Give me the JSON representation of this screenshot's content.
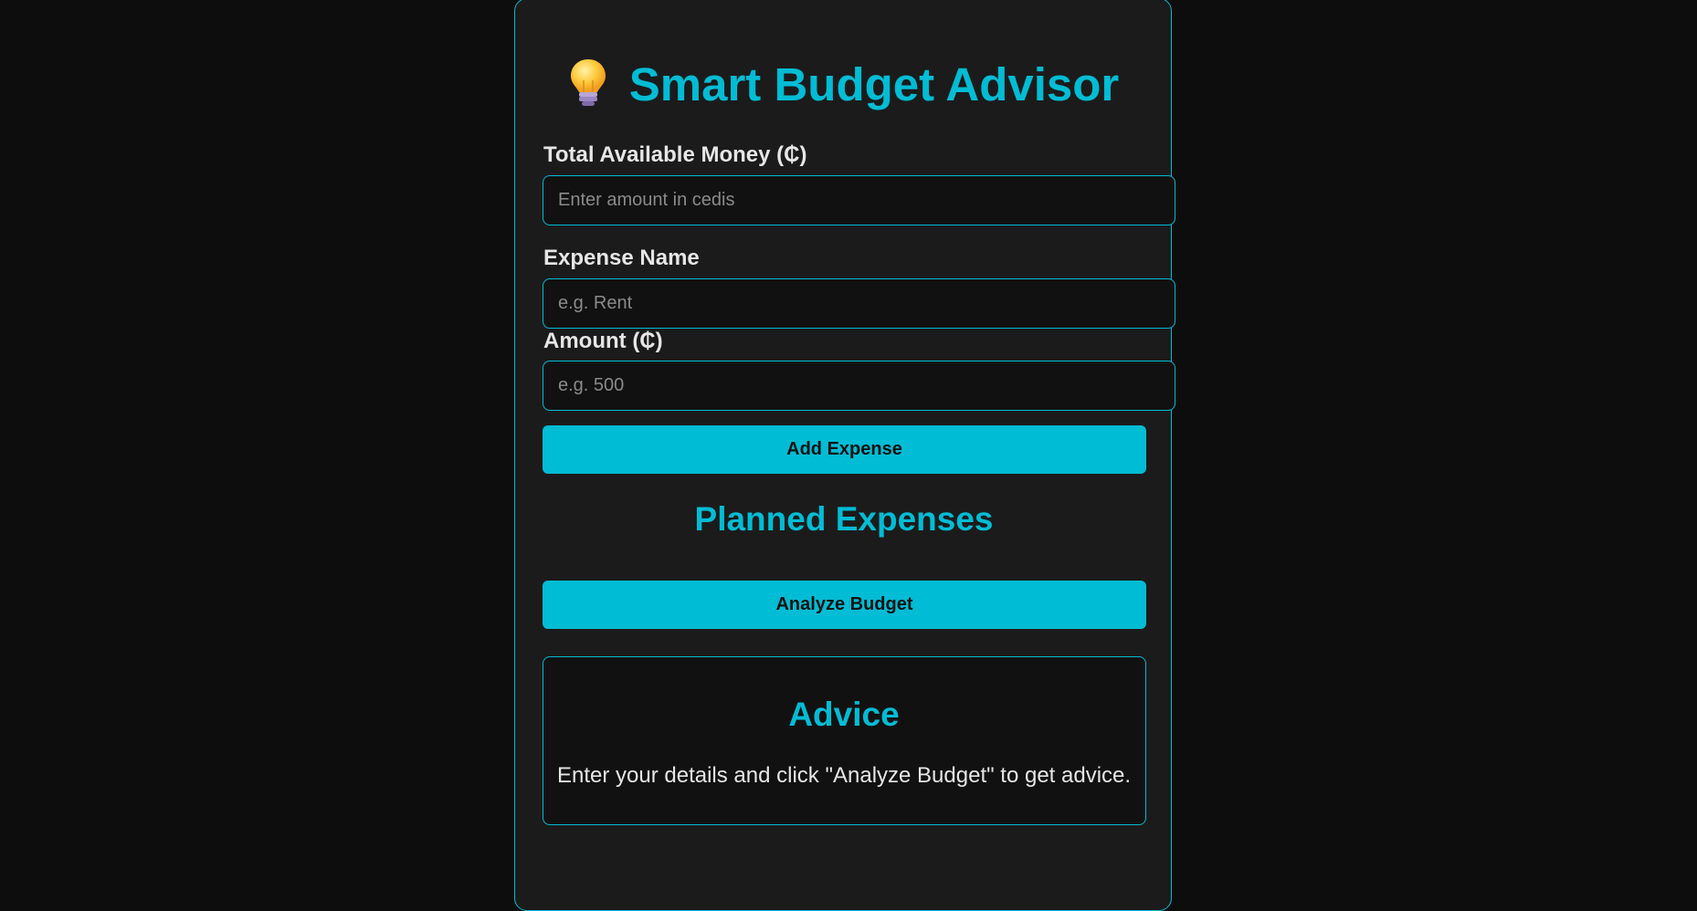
{
  "app": {
    "title": "Smart Budget Advisor",
    "accent_color": "#00bcd4",
    "title_icon": "lightbulb-icon"
  },
  "form": {
    "total_label": "Total Available Money (₵)",
    "total_placeholder": "Enter amount in cedis",
    "expense_name_label": "Expense Name",
    "expense_name_placeholder": "e.g. Rent",
    "amount_label": "Amount (₵)",
    "amount_placeholder": "e.g. 500",
    "add_button_label": "Add Expense"
  },
  "expenses": {
    "heading": "Planned Expenses",
    "items": []
  },
  "analyze": {
    "button_label": "Analyze Budget"
  },
  "advice": {
    "heading": "Advice",
    "text": "Enter your details and click \"Analyze Budget\" to get advice."
  }
}
